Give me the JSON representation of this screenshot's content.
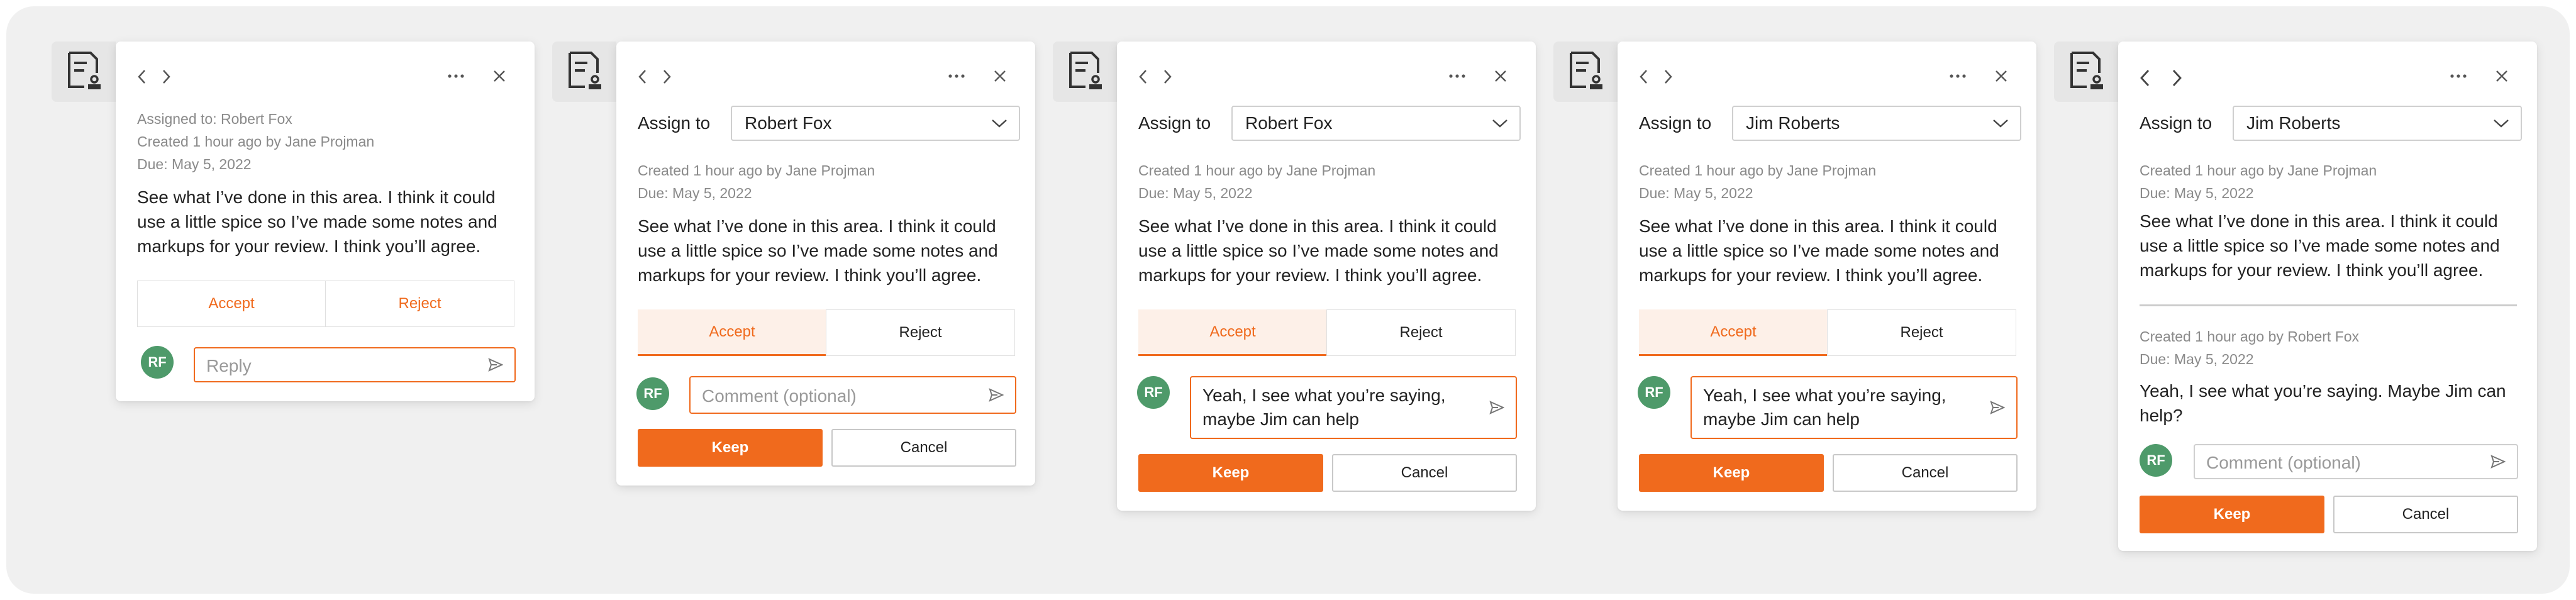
{
  "icons": {
    "back": "chevron-left-icon",
    "forward": "chevron-right-icon",
    "more": "more-icon",
    "close": "close-icon",
    "send": "send-icon",
    "dropdown": "chevron-down-icon",
    "task": "task-document-icon"
  },
  "colors": {
    "accent": "#f06a1d",
    "avatar": "#4e9a6a",
    "accent_tint": "#fdf0e8"
  },
  "cards": [
    {
      "assigned": "Assigned to: Robert Fox",
      "created": "Created 1 hour ago by Jane Projman",
      "due": "Due: May 5, 2022",
      "body": "See what I’ve done in this area. I think it could use a little spice so I’ve made some notes and markups for your review. I think you’ll agree.",
      "accept": "Accept",
      "reject": "Reject",
      "avatar": "RF",
      "reply_placeholder": "Reply"
    },
    {
      "assign_label": "Assign to",
      "assignee": "Robert Fox",
      "created": "Created 1 hour ago by Jane Projman",
      "due": "Due: May 5, 2022",
      "body": "See what I’ve done in this area. I think it could use a little spice so I’ve made some notes and markups for your review. I think you’ll agree.",
      "accept": "Accept",
      "reject": "Reject",
      "avatar": "RF",
      "comment_placeholder": "Comment (optional)",
      "keep": "Keep",
      "cancel": "Cancel"
    },
    {
      "assign_label": "Assign to",
      "assignee": "Robert Fox",
      "created": "Created 1 hour ago by Jane Projman",
      "due": "Due: May 5, 2022",
      "body": "See what I’ve done in this area. I think it could use a little spice so I’ve made some notes and markups for your review. I think you’ll agree.",
      "accept": "Accept",
      "reject": "Reject",
      "avatar": "RF",
      "comment_line1": "Yeah, I see what you’re saying,",
      "comment_line2": "maybe Jim can help",
      "keep": "Keep",
      "cancel": "Cancel"
    },
    {
      "assign_label": "Assign to",
      "assignee": "Jim Roberts",
      "created": "Created 1 hour ago by Jane Projman",
      "due": "Due: May 5, 2022",
      "body": "See what I’ve done in this area. I think it could use a little spice so I’ve made some notes and markups for your review. I think you’ll agree.",
      "accept": "Accept",
      "reject": "Reject",
      "avatar": "RF",
      "comment_line1": "Yeah, I see what you’re saying,",
      "comment_line2": "maybe Jim can help",
      "keep": "Keep",
      "cancel": "Cancel"
    },
    {
      "assign_label": "Assign to",
      "assignee": "Jim Roberts",
      "created": "Created 1 hour ago by Jane Projman",
      "due": "Due: May 5, 2022",
      "body": "See what I’ve done in this area. I think it could use a little spice so I’ve made some notes and markups for your review. I think you’ll agree.",
      "reply_created": "Created 1 hour ago by Robert Fox",
      "reply_due": "Due: May 5, 2022",
      "reply_body": "Yeah, I see what you’re saying. Maybe Jim can help?",
      "avatar": "RF",
      "comment_placeholder": "Comment (optional)",
      "keep": "Keep",
      "cancel": "Cancel"
    }
  ]
}
